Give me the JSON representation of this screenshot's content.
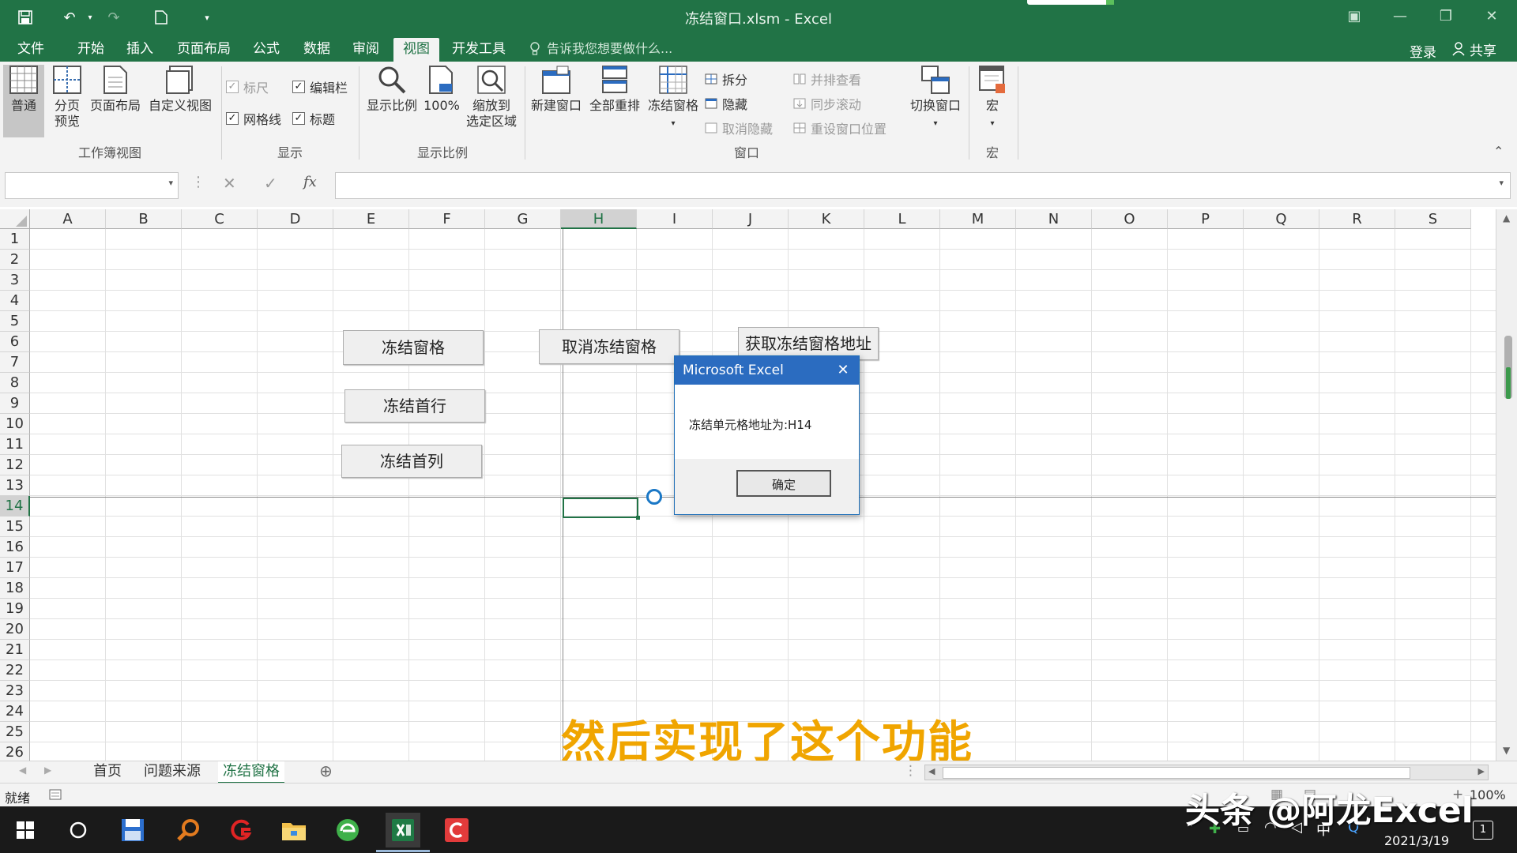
{
  "window": {
    "title": "冻结窗口.xlsm - Excel"
  },
  "menu": {
    "items": [
      "文件",
      "开始",
      "插入",
      "页面布局",
      "公式",
      "数据",
      "审阅",
      "视图",
      "开发工具"
    ],
    "active_index": 7,
    "tell_me": "告诉我您想要做什么...",
    "login": "登录",
    "share": "共享"
  },
  "ribbon": {
    "workbook_views": {
      "label": "工作簿视图",
      "normal": "普通",
      "page_break_1": "分页",
      "page_break_2": "预览",
      "page_layout": "页面布局",
      "custom_views": "自定义视图"
    },
    "show": {
      "label": "显示",
      "ruler": "标尺",
      "formula_bar": "编辑栏",
      "gridlines": "网格线",
      "headings": "标题"
    },
    "zoom": {
      "label": "显示比例",
      "zoom": "显示比例",
      "hundred": "100%",
      "zoom_selection_1": "缩放到",
      "zoom_selection_2": "选定区域"
    },
    "window": {
      "label": "窗口",
      "new_window": "新建窗口",
      "arrange_all": "全部重排",
      "freeze_panes": "冻结窗格",
      "split": "拆分",
      "hide": "隐藏",
      "unhide": "取消隐藏",
      "side_by_side": "并排查看",
      "sync_scroll": "同步滚动",
      "reset_position": "重设窗口位置",
      "switch_windows": "切换窗口"
    },
    "macros": {
      "label": "宏",
      "macros": "宏"
    }
  },
  "formula_bar": {
    "name_box": "",
    "formula": "",
    "fx": "fx"
  },
  "sheet": {
    "columns": [
      "A",
      "B",
      "C",
      "D",
      "E",
      "F",
      "G",
      "H",
      "I",
      "J",
      "K",
      "L",
      "M",
      "N",
      "O",
      "P",
      "Q",
      "R",
      "S"
    ],
    "rows": [
      "1",
      "2",
      "3",
      "4",
      "5",
      "6",
      "7",
      "8",
      "9",
      "10",
      "11",
      "12",
      "13",
      "14",
      "15",
      "16",
      "17",
      "18",
      "19",
      "20",
      "21",
      "22",
      "23",
      "24",
      "25",
      "26"
    ],
    "selected_column": "H",
    "selected_row": "14",
    "buttons": {
      "freeze_panes": "冻结窗格",
      "freeze_top_row": "冻结首行",
      "freeze_first_col": "冻结首列",
      "unfreeze": "取消冻结窗格",
      "get_address": "获取冻结窗格地址"
    }
  },
  "dialog": {
    "title": "Microsoft Excel",
    "message": "冻结单元格地址为:H14",
    "ok": "确定"
  },
  "subtitle": "然后实现了这个功能",
  "tabs": {
    "items": [
      "首页",
      "问题来源",
      "冻结窗格"
    ],
    "active_index": 2
  },
  "status": {
    "ready": "就绪",
    "zoom": "100%"
  },
  "taskbar": {
    "date": "2021/3/19",
    "ime": "中",
    "notifications": "1"
  },
  "watermark": "头条 @阿龙Excel",
  "colors": {
    "excel_green": "#217346",
    "dialog_blue": "#2b6cc0",
    "subtitle_orange": "#f0a500"
  }
}
